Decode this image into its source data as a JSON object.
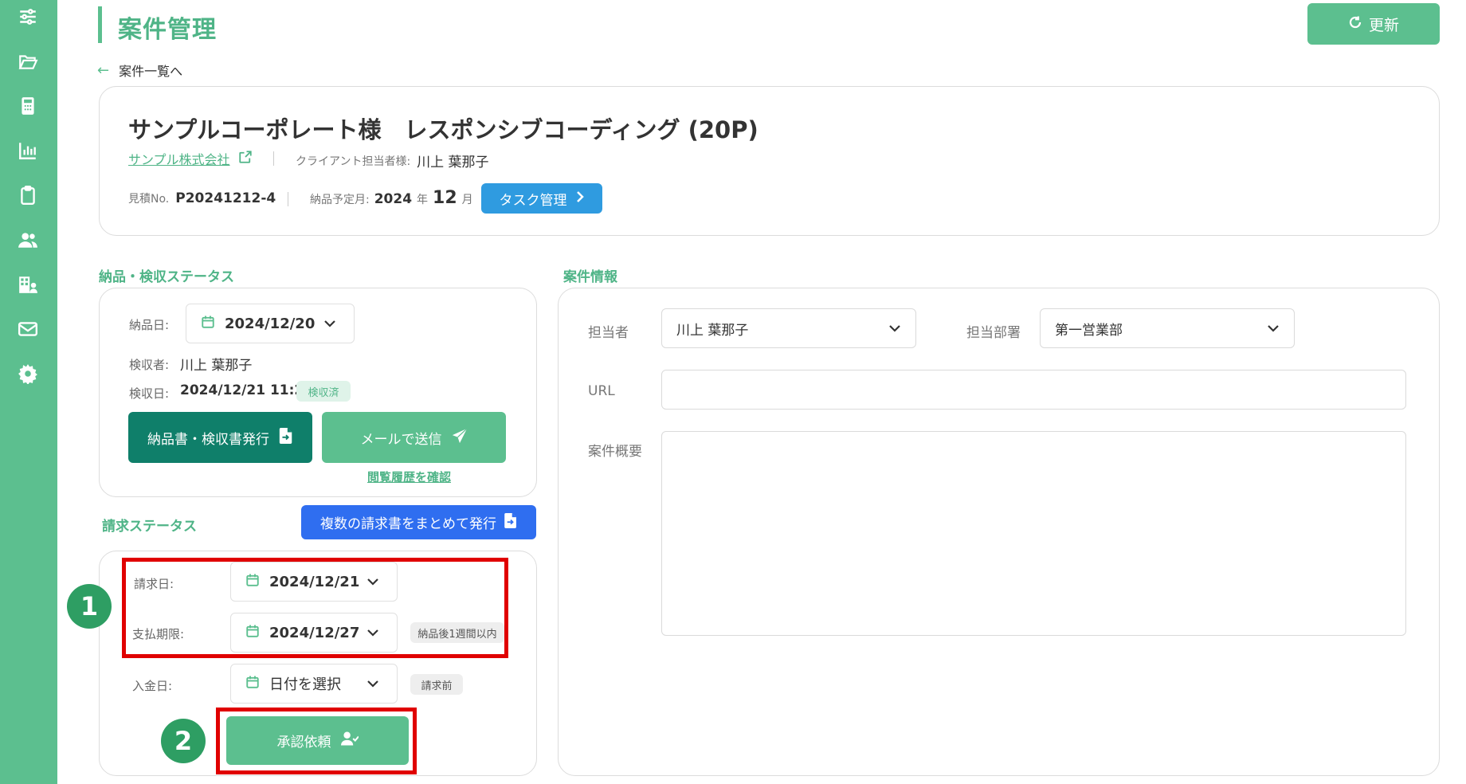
{
  "sidebar": {
    "items": [
      {
        "icon": "sliders-icon"
      },
      {
        "icon": "folder-open-icon"
      },
      {
        "icon": "calculator-icon"
      },
      {
        "icon": "bar-chart-icon"
      },
      {
        "icon": "clipboard-icon"
      },
      {
        "icon": "users-icon"
      },
      {
        "icon": "building-user-icon"
      },
      {
        "icon": "mail-icon"
      },
      {
        "icon": "gear-icon"
      }
    ]
  },
  "header": {
    "title": "案件管理",
    "refresh_label": "更新",
    "back_label": "案件一覧へ"
  },
  "project": {
    "name": "サンプルコーポレート様　レスポンシブコーディング (20P)",
    "client_company": "サンプル株式会社",
    "client_contact_label": "クライアント担当者様:",
    "client_contact": "川上 葉那子",
    "estimate_label": "見積No.",
    "estimate_no": "P20241212-4",
    "delivery_month_label": "納品予定月:",
    "delivery_year": "2024",
    "year_unit": "年",
    "delivery_month": "12",
    "month_unit": "月",
    "task_button": "タスク管理"
  },
  "delivery_status": {
    "section_title": "納品・検収ステータス",
    "delivery_date_label": "納品日:",
    "delivery_date": "2024/12/20",
    "inspector_label": "検収者:",
    "inspector": "川上 葉那子",
    "inspection_date_label": "検収日:",
    "inspection_date": "2024/12/21 11:28",
    "inspection_badge": "検収済",
    "issue_button": "納品書・検収書発行",
    "mail_button": "メールで送信",
    "history_link": "閲覧履歴を確認"
  },
  "billing_status": {
    "section_title": "請求ステータス",
    "bulk_button": "複数の請求書をまとめて発行",
    "invoice_date_label": "請求日:",
    "invoice_date": "2024/12/21",
    "due_date_label": "支払期限:",
    "due_date": "2024/12/27",
    "due_badge": "納品後1週間以内",
    "payment_date_label": "入金日:",
    "payment_date_placeholder": "日付を選択",
    "payment_badge": "請求前",
    "approval_button": "承認依頼"
  },
  "project_info": {
    "section_title": "案件情報",
    "owner_label": "担当者",
    "owner": "川上 葉那子",
    "department_label": "担当部署",
    "department": "第一営業部",
    "url_label": "URL",
    "url_value": "",
    "summary_label": "案件概要",
    "summary_value": ""
  },
  "annotations": {
    "step1": "1",
    "step2": "2"
  },
  "colors": {
    "brand_green": "#5cbf8f",
    "dark_green": "#0f7f6a",
    "blue": "#2f9be0",
    "bulk_blue": "#2f6ef0",
    "highlight_red": "#e00000"
  }
}
